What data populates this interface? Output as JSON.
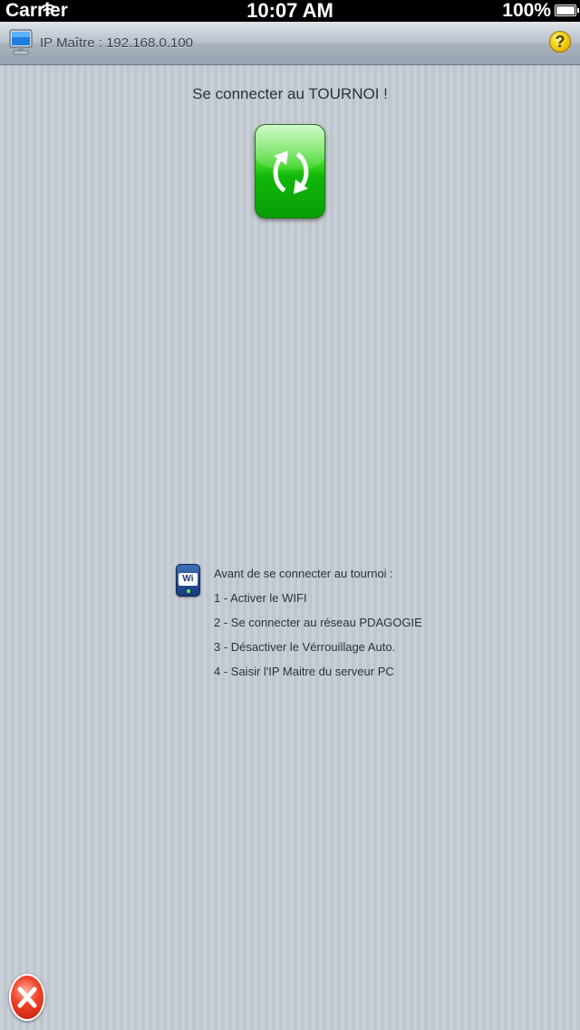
{
  "status_bar": {
    "carrier": "Carrier",
    "time": "10:07 AM",
    "battery": "100%",
    "battery_level_percent": 100
  },
  "header": {
    "title": "IP Maître : 192.168.0.100",
    "help_icon": "question-icon",
    "monitor_icon": "monitor-icon"
  },
  "connect": {
    "title": "Se connecter au TOURNOI !",
    "button_icon": "refresh-icon"
  },
  "instructions": {
    "icon": "wifi-icon",
    "wifi_label": "Wi Fi",
    "items": [
      "Avant de se connecter au tournoi :",
      "1 - Activer le WIFI",
      "2 - Se connecter au réseau PDAGOGIE",
      "3 - Désactiver le Vérrouillage Auto.",
      "4 - Saisir l'IP Maitre du serveur PC"
    ]
  },
  "footer": {
    "close_icon": "close-icon"
  },
  "colors": {
    "status_bar": "#000000",
    "accent_green": "#35d31d",
    "close_red": "#f0442a",
    "help_yellow": "#f6d21b"
  }
}
